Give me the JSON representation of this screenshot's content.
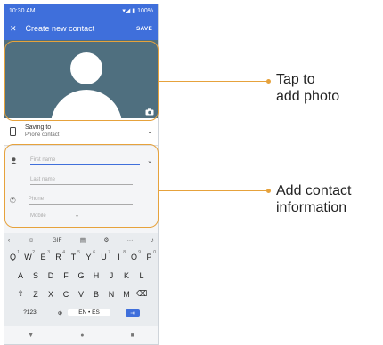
{
  "status": {
    "time": "10:30 AM",
    "battery": "100%"
  },
  "appbar": {
    "title": "Create new contact",
    "save": "SAVE"
  },
  "saving": {
    "label": "Saving to",
    "value": "Phone contact"
  },
  "fields": {
    "first_name": "First name",
    "last_name": "Last name",
    "phone": "Phone",
    "phone_type": "Mobile"
  },
  "keyboard": {
    "suggestions": {
      "gif": "GIF",
      "more": "···"
    },
    "row1": [
      "Q",
      "W",
      "E",
      "R",
      "T",
      "Y",
      "U",
      "I",
      "O",
      "P"
    ],
    "row1_nums": [
      "1",
      "2",
      "3",
      "4",
      "5",
      "6",
      "7",
      "8",
      "9",
      "0"
    ],
    "row2": [
      "A",
      "S",
      "D",
      "F",
      "G",
      "H",
      "J",
      "K",
      "L"
    ],
    "row3": [
      "Z",
      "X",
      "C",
      "V",
      "B",
      "N",
      "M"
    ],
    "symbols": "?123",
    "lang": "EN • ES",
    "period": "."
  },
  "callouts": {
    "photo": [
      "Tap to",
      "add photo"
    ],
    "info": [
      "Add contact",
      "information"
    ]
  },
  "colors": {
    "accent": "#3f6fdb",
    "callout": "#e6a23c"
  }
}
